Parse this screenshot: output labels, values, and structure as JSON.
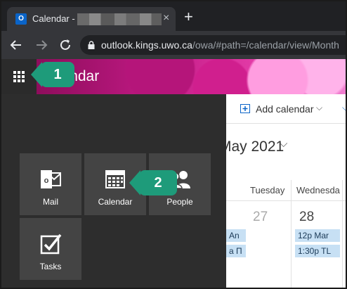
{
  "browser": {
    "tab_title": "Calendar -",
    "tab_close": "×",
    "new_tab": "+",
    "url_host": "outlook.kings.uwo.ca",
    "url_path": "/owa/#path=/calendar/view/Month",
    "icons": [
      "outlook-favicon",
      "close-icon",
      "plus-icon",
      "back-arrow-icon",
      "forward-arrow-icon",
      "reload-icon",
      "lock-icon"
    ]
  },
  "header": {
    "title": "Calendar",
    "icons": [
      "app-launcher-icon"
    ]
  },
  "commands": {
    "add_calendar": "Add calendar",
    "chevron": "⌵",
    "icons": [
      "calendar-plus-icon",
      "chevron-down-icon"
    ]
  },
  "month": {
    "title": "May 2021",
    "title_visible": "ay 2021",
    "chevron": "⌵"
  },
  "days": {
    "headers": [
      "Tuesday",
      "Wednesda"
    ],
    "numbers": [
      "27",
      "28"
    ]
  },
  "events": [
    {
      "text": "An"
    },
    {
      "text": "a Π"
    },
    {
      "text": "12p Mar"
    },
    {
      "text": "1:30p TL"
    }
  ],
  "launcher": {
    "tiles": [
      {
        "label": "Mail",
        "icon": "mail-icon"
      },
      {
        "label": "Calendar",
        "icon": "calendar-icon"
      },
      {
        "label": "People",
        "icon": "people-icon"
      },
      {
        "label": "Tasks",
        "icon": "tasks-icon"
      }
    ]
  },
  "callouts": [
    "1",
    "2"
  ],
  "colors": {
    "callout": "#1e9b7a",
    "event": "#c7e0f4",
    "launcher_bg": "#2d2d2d",
    "tile_bg": "#444444",
    "banner": "#c21a85"
  }
}
